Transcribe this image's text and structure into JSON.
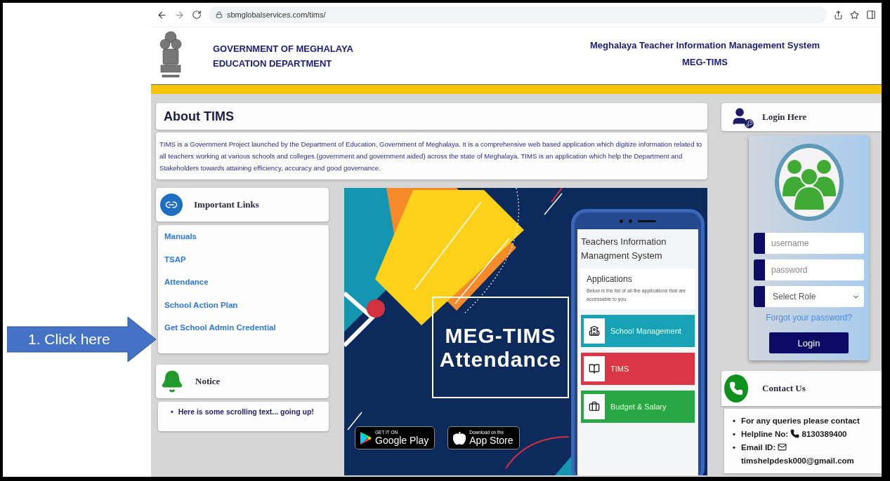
{
  "browser": {
    "url": "sbmglobalservices.com/tims/"
  },
  "header": {
    "org_lines": [
      "GOVERNMENT OF MEGHALAYA",
      "EDUCATION DEPARTMENT"
    ],
    "system_title": "Meghalaya Teacher Information Management System",
    "system_short": "MEG-TIMS"
  },
  "about": {
    "title": "About TIMS",
    "text": "TIMS is a Government Project launched by the Department of Education, Government of Meghalaya. It is a comprehensive web based application which digitize information related to all teachers working at various schools and colleges (government and government aided) across the state of Meghalaya. TIMS is an application which help the Department and Stakeholders towards attaining efficiency, accuracy and good governance."
  },
  "important_links": {
    "title": "Important Links",
    "links": [
      "Manuals",
      "TSAP",
      "Attendance",
      "School Action Plan",
      "Get School Admin Credential"
    ]
  },
  "notice": {
    "title": "Notice",
    "items": [
      {
        "bullet": "•",
        "text": "Here is some scrolling text... going up!"
      }
    ]
  },
  "banner": {
    "title_lines": [
      "MEG-TIMS",
      "Attendance"
    ],
    "phone": {
      "title": "Teachers Information Managment System",
      "section_title": "Applications",
      "section_text": "Below is the list of all the applications that are accessable to you.",
      "apps": [
        {
          "label": "School Management",
          "kind": "school",
          "color": "#17a2b8"
        },
        {
          "label": "TIMS",
          "kind": "book",
          "color": "#dc3545"
        },
        {
          "label": "Budget & Salary",
          "kind": "briefcase",
          "color": "#28a745"
        }
      ]
    },
    "badges": [
      {
        "kind": "google",
        "small": "GET IT ON",
        "big": "Google Play"
      },
      {
        "kind": "apple",
        "small": "Download on the",
        "big": "App Store"
      }
    ]
  },
  "login": {
    "title": "Login Here",
    "username_placeholder": "username",
    "password_placeholder": "password",
    "role_placeholder": "Select Role",
    "forgot": "Forgot your password?",
    "button": "Login"
  },
  "contact": {
    "title": "Contact Us",
    "items": [
      {
        "kind": "text",
        "bullet": "•",
        "label": "For any queries please contact"
      },
      {
        "kind": "phone",
        "bullet": "•",
        "label": "Helpline No:",
        "value": "8130389400"
      },
      {
        "kind": "email",
        "bullet": "•",
        "label": "Email ID:",
        "value": "timshelpdesk000@gmail.com"
      }
    ]
  },
  "annotation": {
    "text": "1. Click here"
  }
}
